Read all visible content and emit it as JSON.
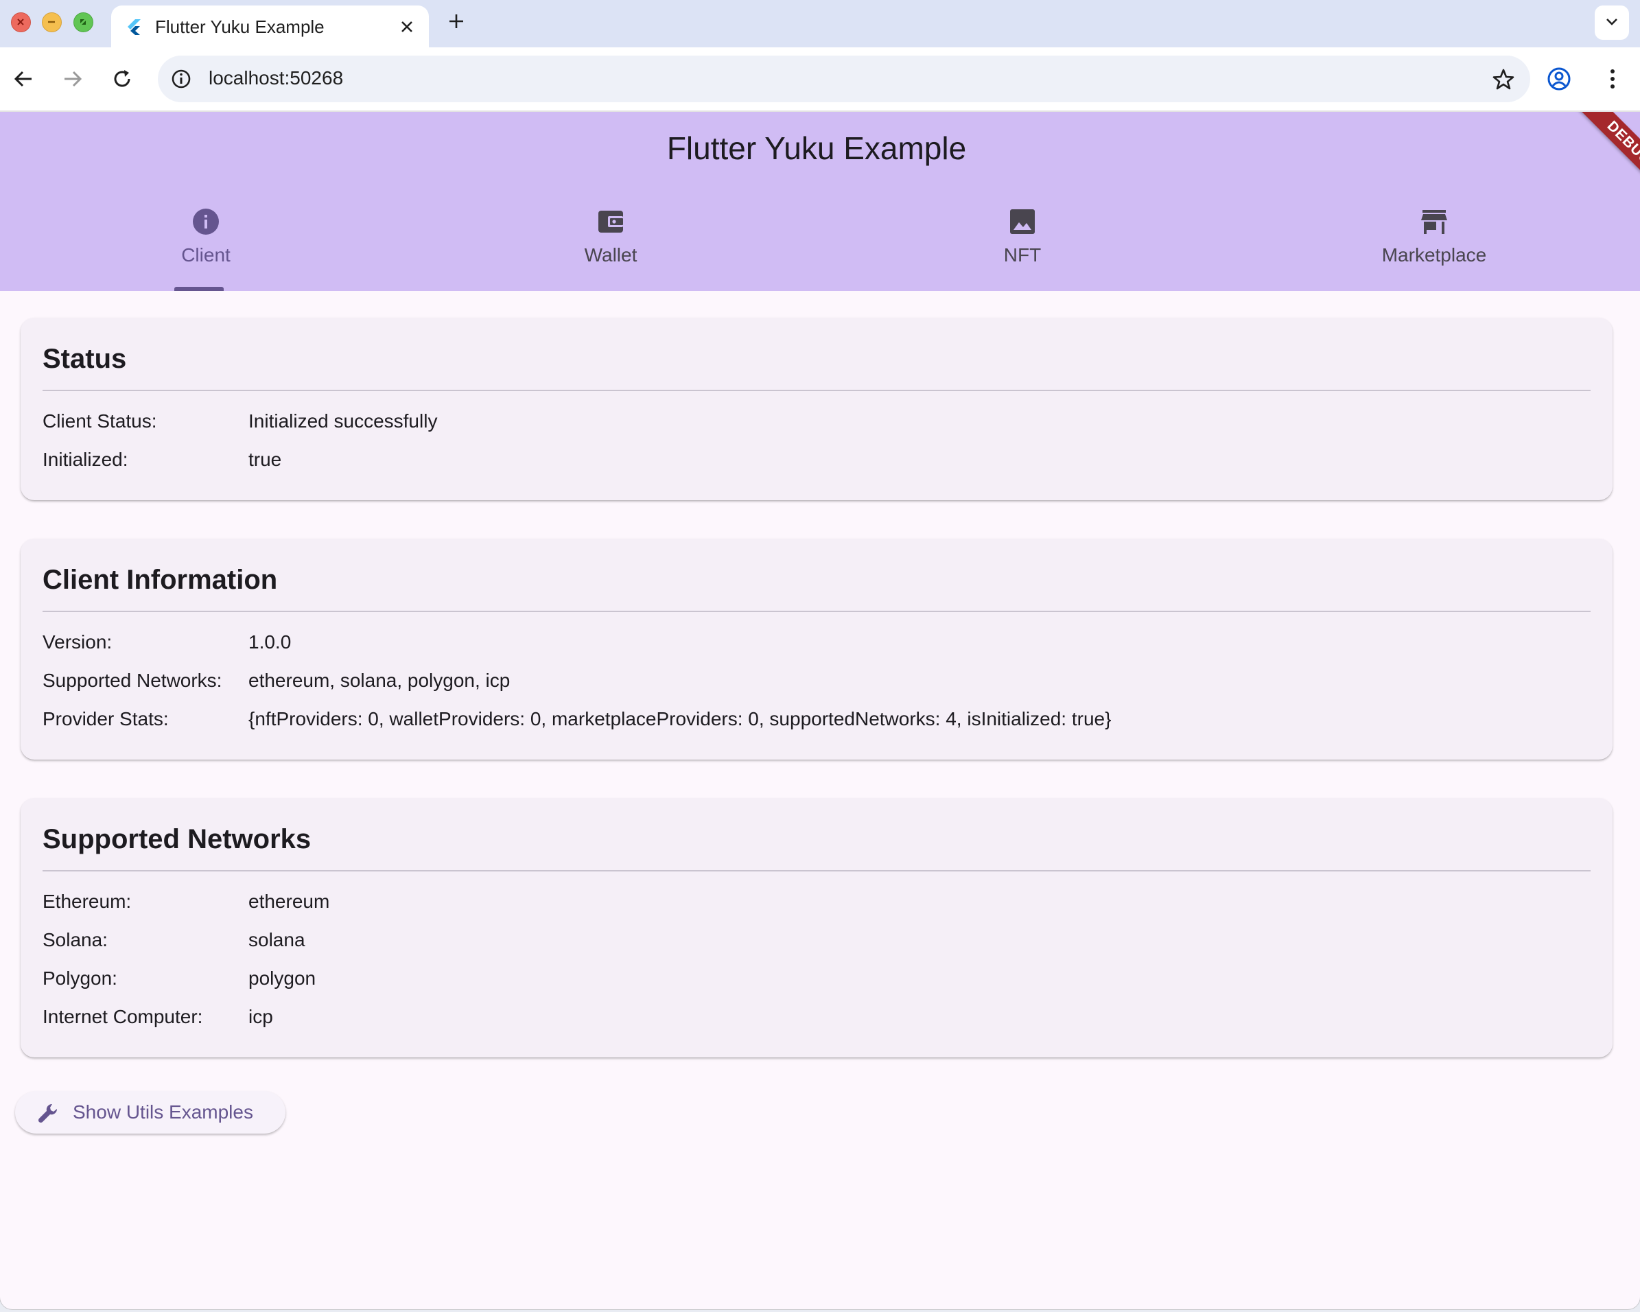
{
  "browser": {
    "tab_title": "Flutter Yuku Example",
    "url": "localhost:50268"
  },
  "app": {
    "title": "Flutter Yuku Example",
    "debug_banner": "DEBUG",
    "tabs": [
      {
        "label": "Client",
        "icon": "info-icon",
        "active": true
      },
      {
        "label": "Wallet",
        "icon": "wallet-icon",
        "active": false
      },
      {
        "label": "NFT",
        "icon": "image-icon",
        "active": false
      },
      {
        "label": "Marketplace",
        "icon": "store-icon",
        "active": false
      }
    ]
  },
  "status": {
    "title": "Status",
    "rows": [
      {
        "key": "Client Status:",
        "value": "Initialized successfully"
      },
      {
        "key": "Initialized:",
        "value": "true"
      }
    ]
  },
  "client_info": {
    "title": "Client Information",
    "rows": [
      {
        "key": "Version:",
        "value": "1.0.0"
      },
      {
        "key": "Supported Networks:",
        "value": "ethereum, solana, polygon, icp"
      },
      {
        "key": "Provider Stats:",
        "value": "{nftProviders: 0, walletProviders: 0, marketplaceProviders: 0, supportedNetworks: 4, isInitialized: true}"
      }
    ]
  },
  "networks": {
    "title": "Supported Networks",
    "rows": [
      {
        "key": "Ethereum:",
        "value": "ethereum"
      },
      {
        "key": "Solana:",
        "value": "solana"
      },
      {
        "key": "Polygon:",
        "value": "polygon"
      },
      {
        "key": "Internet Computer:",
        "value": "icp"
      }
    ]
  },
  "utils_button": {
    "label": "Show Utils Examples",
    "icon": "wrench-icon"
  },
  "colors": {
    "appbar": "#d0bcf4",
    "primary": "#65558f",
    "surface": "#fdf7fd",
    "debug": "#a5282c"
  }
}
